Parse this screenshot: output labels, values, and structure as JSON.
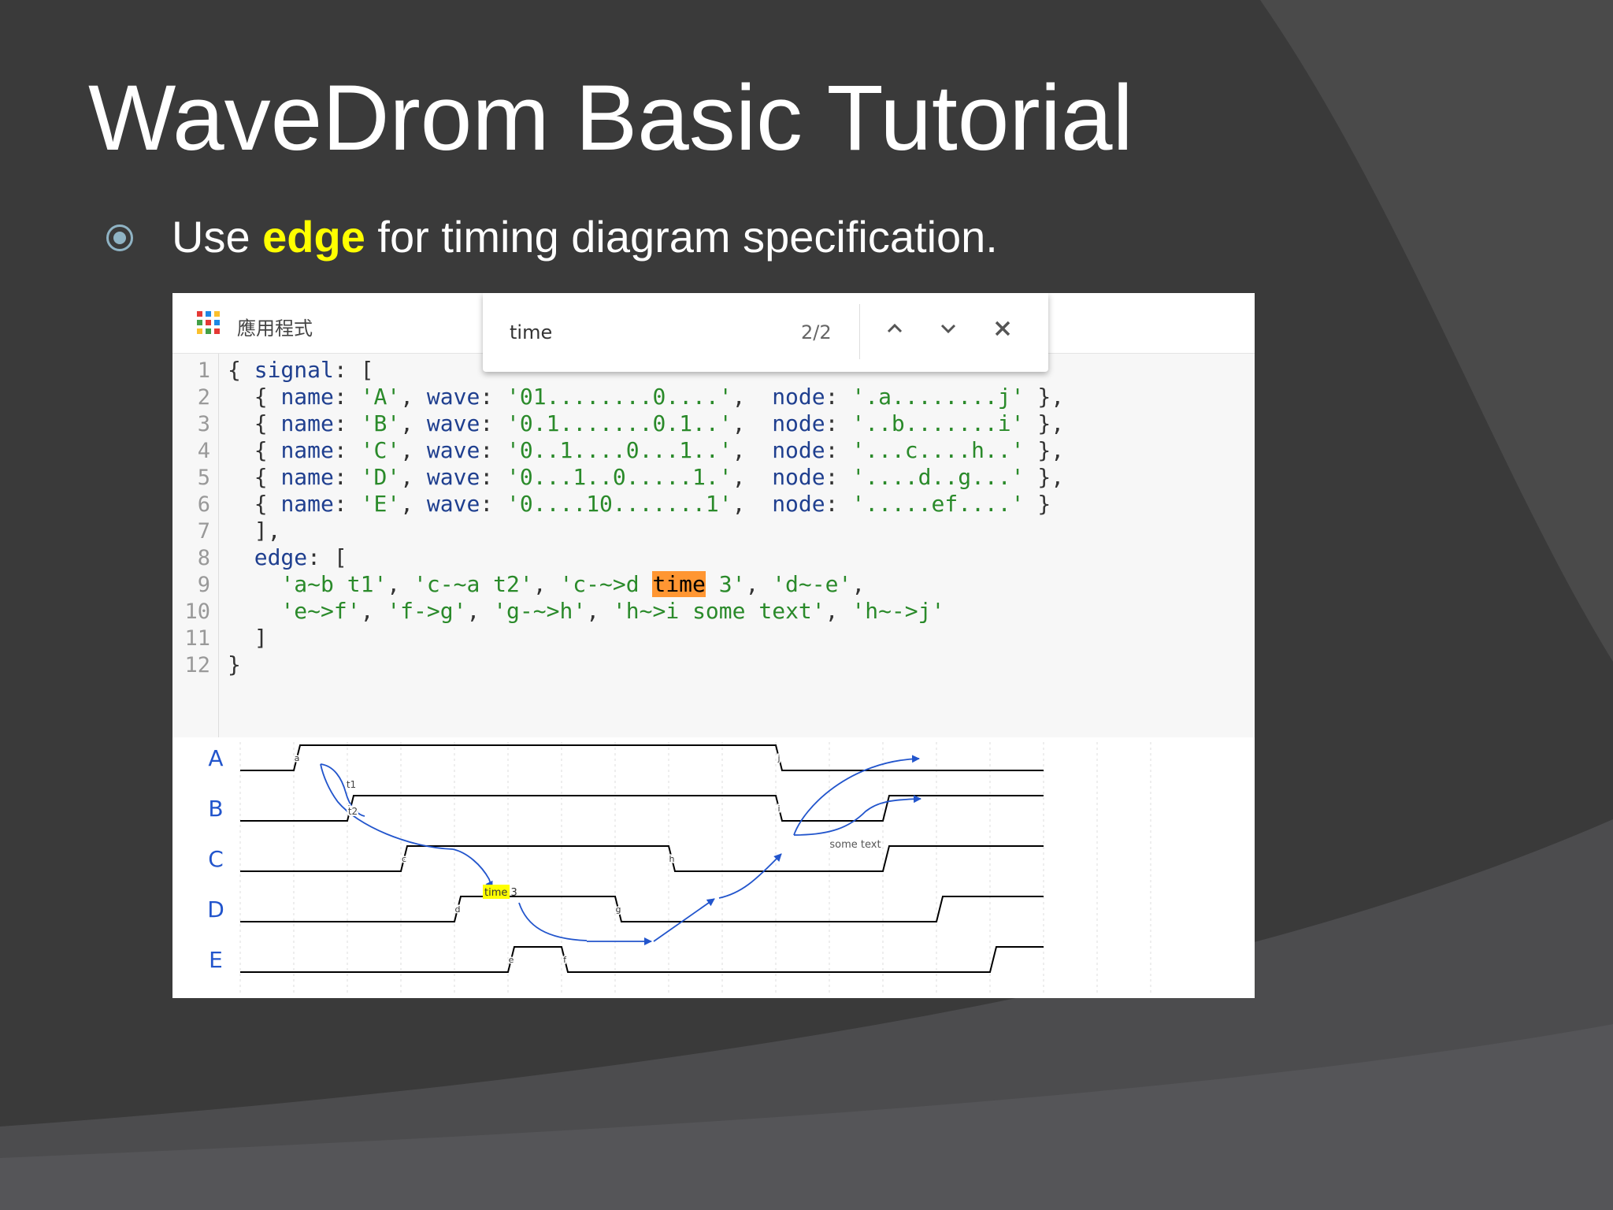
{
  "slide": {
    "title": "WaveDrom Basic Tutorial",
    "bullet_prefix": "Use ",
    "bullet_highlight": "edge",
    "bullet_suffix": " for timing diagram specification."
  },
  "browser": {
    "apps_label": "應用程式",
    "find": {
      "query": "time",
      "count": "2/2"
    }
  },
  "editor": {
    "line_numbers": [
      "1",
      "2",
      "3",
      "4",
      "5",
      "6",
      "7",
      "8",
      "9",
      "10",
      "11",
      "12"
    ],
    "lines": [
      [
        {
          "t": "{ ",
          "c": "p"
        },
        {
          "t": "signal",
          "c": "k"
        },
        {
          "t": ": [",
          "c": "p"
        }
      ],
      [
        {
          "t": "  { ",
          "c": "p"
        },
        {
          "t": "name",
          "c": "k"
        },
        {
          "t": ": ",
          "c": "p"
        },
        {
          "t": "'A'",
          "c": "s"
        },
        {
          "t": ", ",
          "c": "p"
        },
        {
          "t": "wave",
          "c": "k"
        },
        {
          "t": ": ",
          "c": "p"
        },
        {
          "t": "'01........0....'",
          "c": "s"
        },
        {
          "t": ",  ",
          "c": "p"
        },
        {
          "t": "node",
          "c": "k"
        },
        {
          "t": ": ",
          "c": "p"
        },
        {
          "t": "'.a........j'",
          "c": "s"
        },
        {
          "t": " },",
          "c": "p"
        }
      ],
      [
        {
          "t": "  { ",
          "c": "p"
        },
        {
          "t": "name",
          "c": "k"
        },
        {
          "t": ": ",
          "c": "p"
        },
        {
          "t": "'B'",
          "c": "s"
        },
        {
          "t": ", ",
          "c": "p"
        },
        {
          "t": "wave",
          "c": "k"
        },
        {
          "t": ": ",
          "c": "p"
        },
        {
          "t": "'0.1.......0.1..'",
          "c": "s"
        },
        {
          "t": ",  ",
          "c": "p"
        },
        {
          "t": "node",
          "c": "k"
        },
        {
          "t": ": ",
          "c": "p"
        },
        {
          "t": "'..b.......i'",
          "c": "s"
        },
        {
          "t": " },",
          "c": "p"
        }
      ],
      [
        {
          "t": "  { ",
          "c": "p"
        },
        {
          "t": "name",
          "c": "k"
        },
        {
          "t": ": ",
          "c": "p"
        },
        {
          "t": "'C'",
          "c": "s"
        },
        {
          "t": ", ",
          "c": "p"
        },
        {
          "t": "wave",
          "c": "k"
        },
        {
          "t": ": ",
          "c": "p"
        },
        {
          "t": "'0..1....0...1..'",
          "c": "s"
        },
        {
          "t": ",  ",
          "c": "p"
        },
        {
          "t": "node",
          "c": "k"
        },
        {
          "t": ": ",
          "c": "p"
        },
        {
          "t": "'...c....h..'",
          "c": "s"
        },
        {
          "t": " },",
          "c": "p"
        }
      ],
      [
        {
          "t": "  { ",
          "c": "p"
        },
        {
          "t": "name",
          "c": "k"
        },
        {
          "t": ": ",
          "c": "p"
        },
        {
          "t": "'D'",
          "c": "s"
        },
        {
          "t": ", ",
          "c": "p"
        },
        {
          "t": "wave",
          "c": "k"
        },
        {
          "t": ": ",
          "c": "p"
        },
        {
          "t": "'0...1..0.....1.'",
          "c": "s"
        },
        {
          "t": ",  ",
          "c": "p"
        },
        {
          "t": "node",
          "c": "k"
        },
        {
          "t": ": ",
          "c": "p"
        },
        {
          "t": "'....d..g...'",
          "c": "s"
        },
        {
          "t": " },",
          "c": "p"
        }
      ],
      [
        {
          "t": "  { ",
          "c": "p"
        },
        {
          "t": "name",
          "c": "k"
        },
        {
          "t": ": ",
          "c": "p"
        },
        {
          "t": "'E'",
          "c": "s"
        },
        {
          "t": ", ",
          "c": "p"
        },
        {
          "t": "wave",
          "c": "k"
        },
        {
          "t": ": ",
          "c": "p"
        },
        {
          "t": "'0....10.......1'",
          "c": "s"
        },
        {
          "t": ",  ",
          "c": "p"
        },
        {
          "t": "node",
          "c": "k"
        },
        {
          "t": ": ",
          "c": "p"
        },
        {
          "t": "'.....ef....'",
          "c": "s"
        },
        {
          "t": " }",
          "c": "p"
        }
      ],
      [
        {
          "t": "  ],",
          "c": "p"
        }
      ],
      [
        {
          "t": "  ",
          "c": "p"
        },
        {
          "t": "edge",
          "c": "k"
        },
        {
          "t": ": [",
          "c": "p"
        }
      ],
      [
        {
          "t": "    ",
          "c": "p"
        },
        {
          "t": "'a~b t1'",
          "c": "s"
        },
        {
          "t": ", ",
          "c": "p"
        },
        {
          "t": "'c-~a t2'",
          "c": "s"
        },
        {
          "t": ", ",
          "c": "p"
        },
        {
          "t": "'c-~>d ",
          "c": "s"
        },
        {
          "t": "time",
          "c": "match"
        },
        {
          "t": " 3'",
          "c": "s"
        },
        {
          "t": ", ",
          "c": "p"
        },
        {
          "t": "'d~-e'",
          "c": "s"
        },
        {
          "t": ",",
          "c": "p"
        }
      ],
      [
        {
          "t": "    ",
          "c": "p"
        },
        {
          "t": "'e~>f'",
          "c": "s"
        },
        {
          "t": ", ",
          "c": "p"
        },
        {
          "t": "'f->g'",
          "c": "s"
        },
        {
          "t": ", ",
          "c": "p"
        },
        {
          "t": "'g-~>h'",
          "c": "s"
        },
        {
          "t": ", ",
          "c": "p"
        },
        {
          "t": "'h~>i some text'",
          "c": "s"
        },
        {
          "t": ", ",
          "c": "p"
        },
        {
          "t": "'h~->j'",
          "c": "s"
        }
      ],
      [
        {
          "t": "  ]",
          "c": "p"
        }
      ],
      [
        {
          "t": "}",
          "c": "p"
        }
      ]
    ]
  },
  "timing": {
    "signals": [
      {
        "name": "A",
        "wave": "01........0...."
      },
      {
        "name": "B",
        "wave": "0.1.......0.1.."
      },
      {
        "name": "C",
        "wave": "0..1....0...1.."
      },
      {
        "name": "D",
        "wave": "0...1..0.....1."
      },
      {
        "name": "E",
        "wave": "0....10.......1"
      }
    ],
    "nodes": {
      "a": "a",
      "b": "b",
      "c": "c",
      "d": "d",
      "e": "e",
      "f": "f",
      "g": "g",
      "h": "h",
      "i": "i",
      "j": "j"
    },
    "edge_labels": {
      "t1": "t1",
      "t2": "t2",
      "time3_hl": "time",
      "time3_rest": " 3",
      "some_text": "some text"
    },
    "colors": {
      "edge": "#2255cc",
      "highlight": "#ffff00"
    }
  }
}
